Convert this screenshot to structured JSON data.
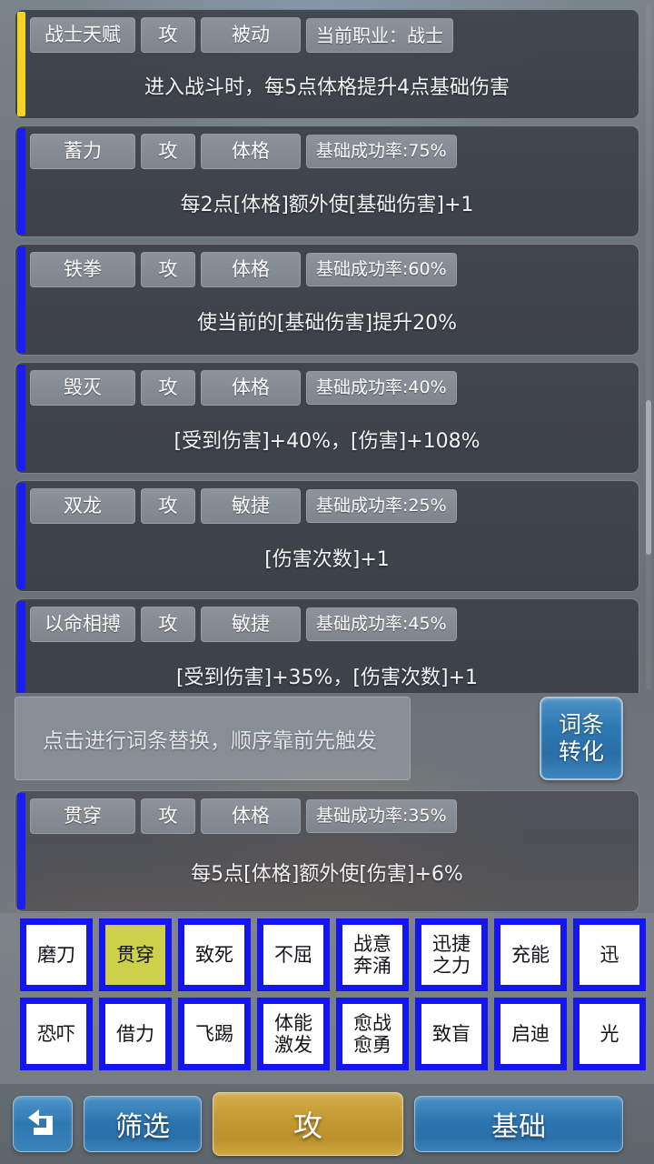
{
  "theme": {
    "accent_gold": "#f2d51e",
    "accent_blue": "#1a1ef5",
    "tile_border": "#1515f0",
    "tile_selected_bg": "#ccd04a",
    "button_blue": "#2f79b3",
    "button_gold": "#c49a33"
  },
  "skill_cards": [
    {
      "name": "战士天赋",
      "type": "攻",
      "stat": "被动",
      "rate": "当前职业：战士",
      "desc": "进入战斗时，每5点体格提升4点基础伤害",
      "accent": "gold"
    },
    {
      "name": "蓄力",
      "type": "攻",
      "stat": "体格",
      "rate": "基础成功率:75%",
      "desc": "每2点[体格]额外使[基础伤害]+1",
      "accent": "blue"
    },
    {
      "name": "铁拳",
      "type": "攻",
      "stat": "体格",
      "rate": "基础成功率:60%",
      "desc": "使当前的[基础伤害]提升20%",
      "accent": "blue"
    },
    {
      "name": "毁灭",
      "type": "攻",
      "stat": "体格",
      "rate": "基础成功率:40%",
      "desc": "[受到伤害]+40%，[伤害]+108%",
      "accent": "blue"
    },
    {
      "name": "双龙",
      "type": "攻",
      "stat": "敏捷",
      "rate": "基础成功率:25%",
      "desc": "[伤害次数]+1",
      "accent": "blue"
    },
    {
      "name": "以命相搏",
      "type": "攻",
      "stat": "敏捷",
      "rate": "基础成功率:45%",
      "desc": "[受到伤害]+35%，[伤害次数]+1",
      "accent": "blue"
    }
  ],
  "replace": {
    "hint": "点击进行词条替换，顺序靠前先触发",
    "convert_line1": "词条",
    "convert_line2": "转化"
  },
  "highlight_card": {
    "name": "贯穿",
    "type": "攻",
    "stat": "体格",
    "rate": "基础成功率:35%",
    "desc": "每5点[体格]额外使[伤害]+6%",
    "accent": "blue"
  },
  "skill_grid": {
    "row1": [
      {
        "label": "磨刀",
        "selected": false
      },
      {
        "label": "贯穿",
        "selected": true
      },
      {
        "label": "致死",
        "selected": false
      },
      {
        "label": "不屈",
        "selected": false
      },
      {
        "label": "战意奔涌",
        "selected": false
      },
      {
        "label": "迅捷之力",
        "selected": false
      },
      {
        "label": "充能",
        "selected": false
      },
      {
        "label": "迅",
        "selected": false
      }
    ],
    "row2": [
      {
        "label": "恐吓",
        "selected": false
      },
      {
        "label": "借力",
        "selected": false
      },
      {
        "label": "飞踢",
        "selected": false
      },
      {
        "label": "体能激发",
        "selected": false
      },
      {
        "label": "愈战愈勇",
        "selected": false
      },
      {
        "label": "致盲",
        "selected": false
      },
      {
        "label": "启迪",
        "selected": false
      },
      {
        "label": "光",
        "selected": false
      }
    ]
  },
  "toolbar": {
    "back_icon": "return-arrow-icon",
    "filter_label": "筛选",
    "attack_label": "攻",
    "basic_label": "基础"
  }
}
